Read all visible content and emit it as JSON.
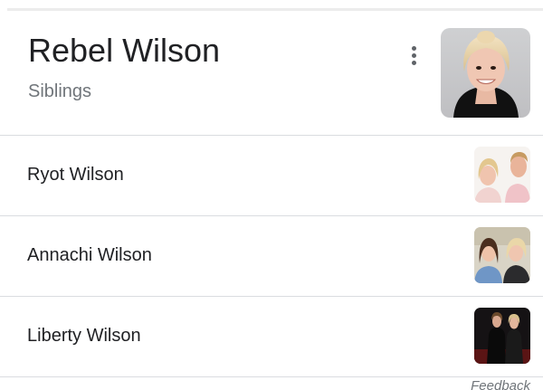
{
  "entity": {
    "title": "Rebel Wilson",
    "subtitle": "Siblings"
  },
  "icons": {
    "more_options": "more-vert-icon"
  },
  "siblings": [
    {
      "name": "Ryot Wilson"
    },
    {
      "name": "Annachi Wilson"
    },
    {
      "name": "Liberty Wilson"
    }
  ],
  "footer": {
    "feedback_label": "Feedback"
  },
  "colors": {
    "title_text": "#202124",
    "secondary_text": "#70757a",
    "divider": "#dadce0",
    "background": "#ffffff"
  }
}
